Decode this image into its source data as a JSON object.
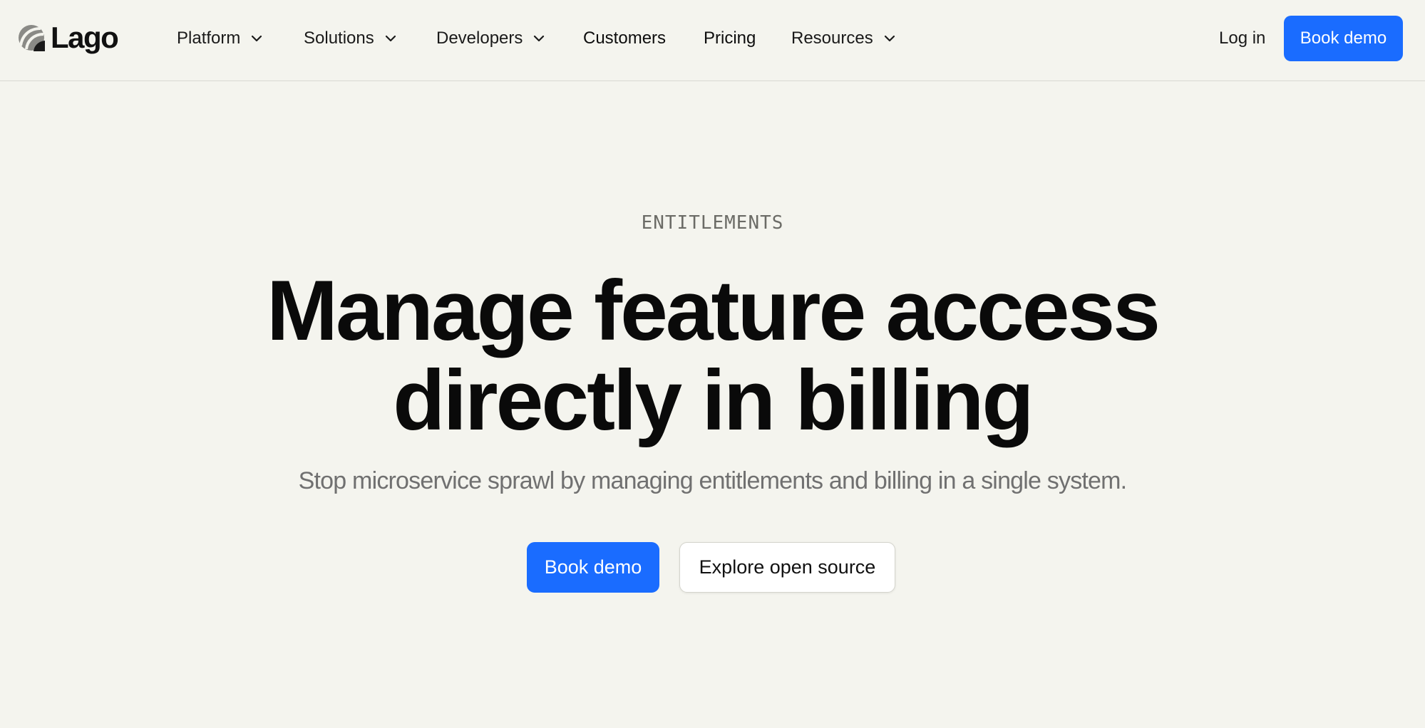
{
  "brand": {
    "name": "Lago",
    "logo_icon": "lago-logo-icon"
  },
  "nav": {
    "items": [
      {
        "label": "Platform",
        "has_dropdown": true
      },
      {
        "label": "Solutions",
        "has_dropdown": true
      },
      {
        "label": "Developers",
        "has_dropdown": true
      },
      {
        "label": "Customers",
        "has_dropdown": false
      },
      {
        "label": "Pricing",
        "has_dropdown": false
      },
      {
        "label": "Resources",
        "has_dropdown": true
      }
    ],
    "dropdown_icon": "chevron-down-icon",
    "login_label": "Log in",
    "demo_label": "Book demo"
  },
  "hero": {
    "eyebrow": "ENTITLEMENTS",
    "headline_line1": "Manage feature access",
    "headline_line2": "directly in billing",
    "subhead": "Stop microservice sprawl by managing entitlements and billing in a single system.",
    "primary_cta": "Book demo",
    "secondary_cta": "Explore open source"
  },
  "colors": {
    "background": "#f4f4ee",
    "accent": "#1a6cff",
    "text": "#0a0a0a",
    "muted_text": "#707070"
  }
}
